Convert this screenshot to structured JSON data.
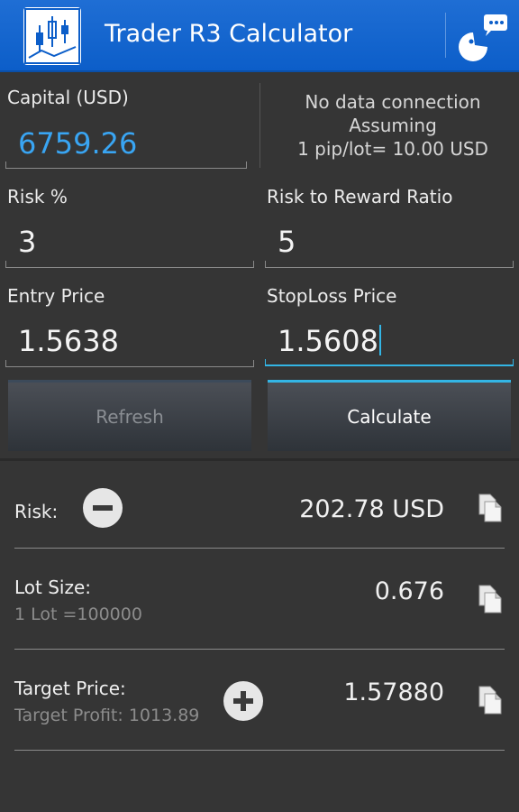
{
  "app": {
    "title": "Trader R3 Calculator"
  },
  "form": {
    "capital_label": "Capital   (USD)",
    "capital_value": "6759.26",
    "connection_status": {
      "line1": "No data connection",
      "line2": "Assuming",
      "line3": "1 pip/lot= 10.00 USD"
    },
    "risk_label": "Risk %",
    "risk_value": "3",
    "rr_label": "Risk to Reward Ratio",
    "rr_value": "5",
    "entry_label": "Entry Price",
    "entry_value": "1.5638",
    "stoploss_label": "StopLoss Price",
    "stoploss_value": "1.5608"
  },
  "buttons": {
    "refresh": "Refresh",
    "calculate": "Calculate"
  },
  "results": {
    "risk_label": "Risk:",
    "risk_value": "202.78 USD",
    "lot_label": "Lot Size:",
    "lot_sub": "1 Lot =100000",
    "lot_value": "0.676",
    "target_label": "Target Price:",
    "target_sub": "Target Profit: 1013.89",
    "target_value": "1.57880"
  },
  "icons": {
    "app": "candlestick-chart-icon",
    "chat": "chat-bubble-icon",
    "minus": "minus-circle-icon",
    "plus": "plus-circle-icon",
    "copy": "copy-icon"
  },
  "colors": {
    "actionbar": "#0c5ec9",
    "accent": "#33b5e5",
    "capital_text": "#39a5f3",
    "background": "#353535"
  }
}
